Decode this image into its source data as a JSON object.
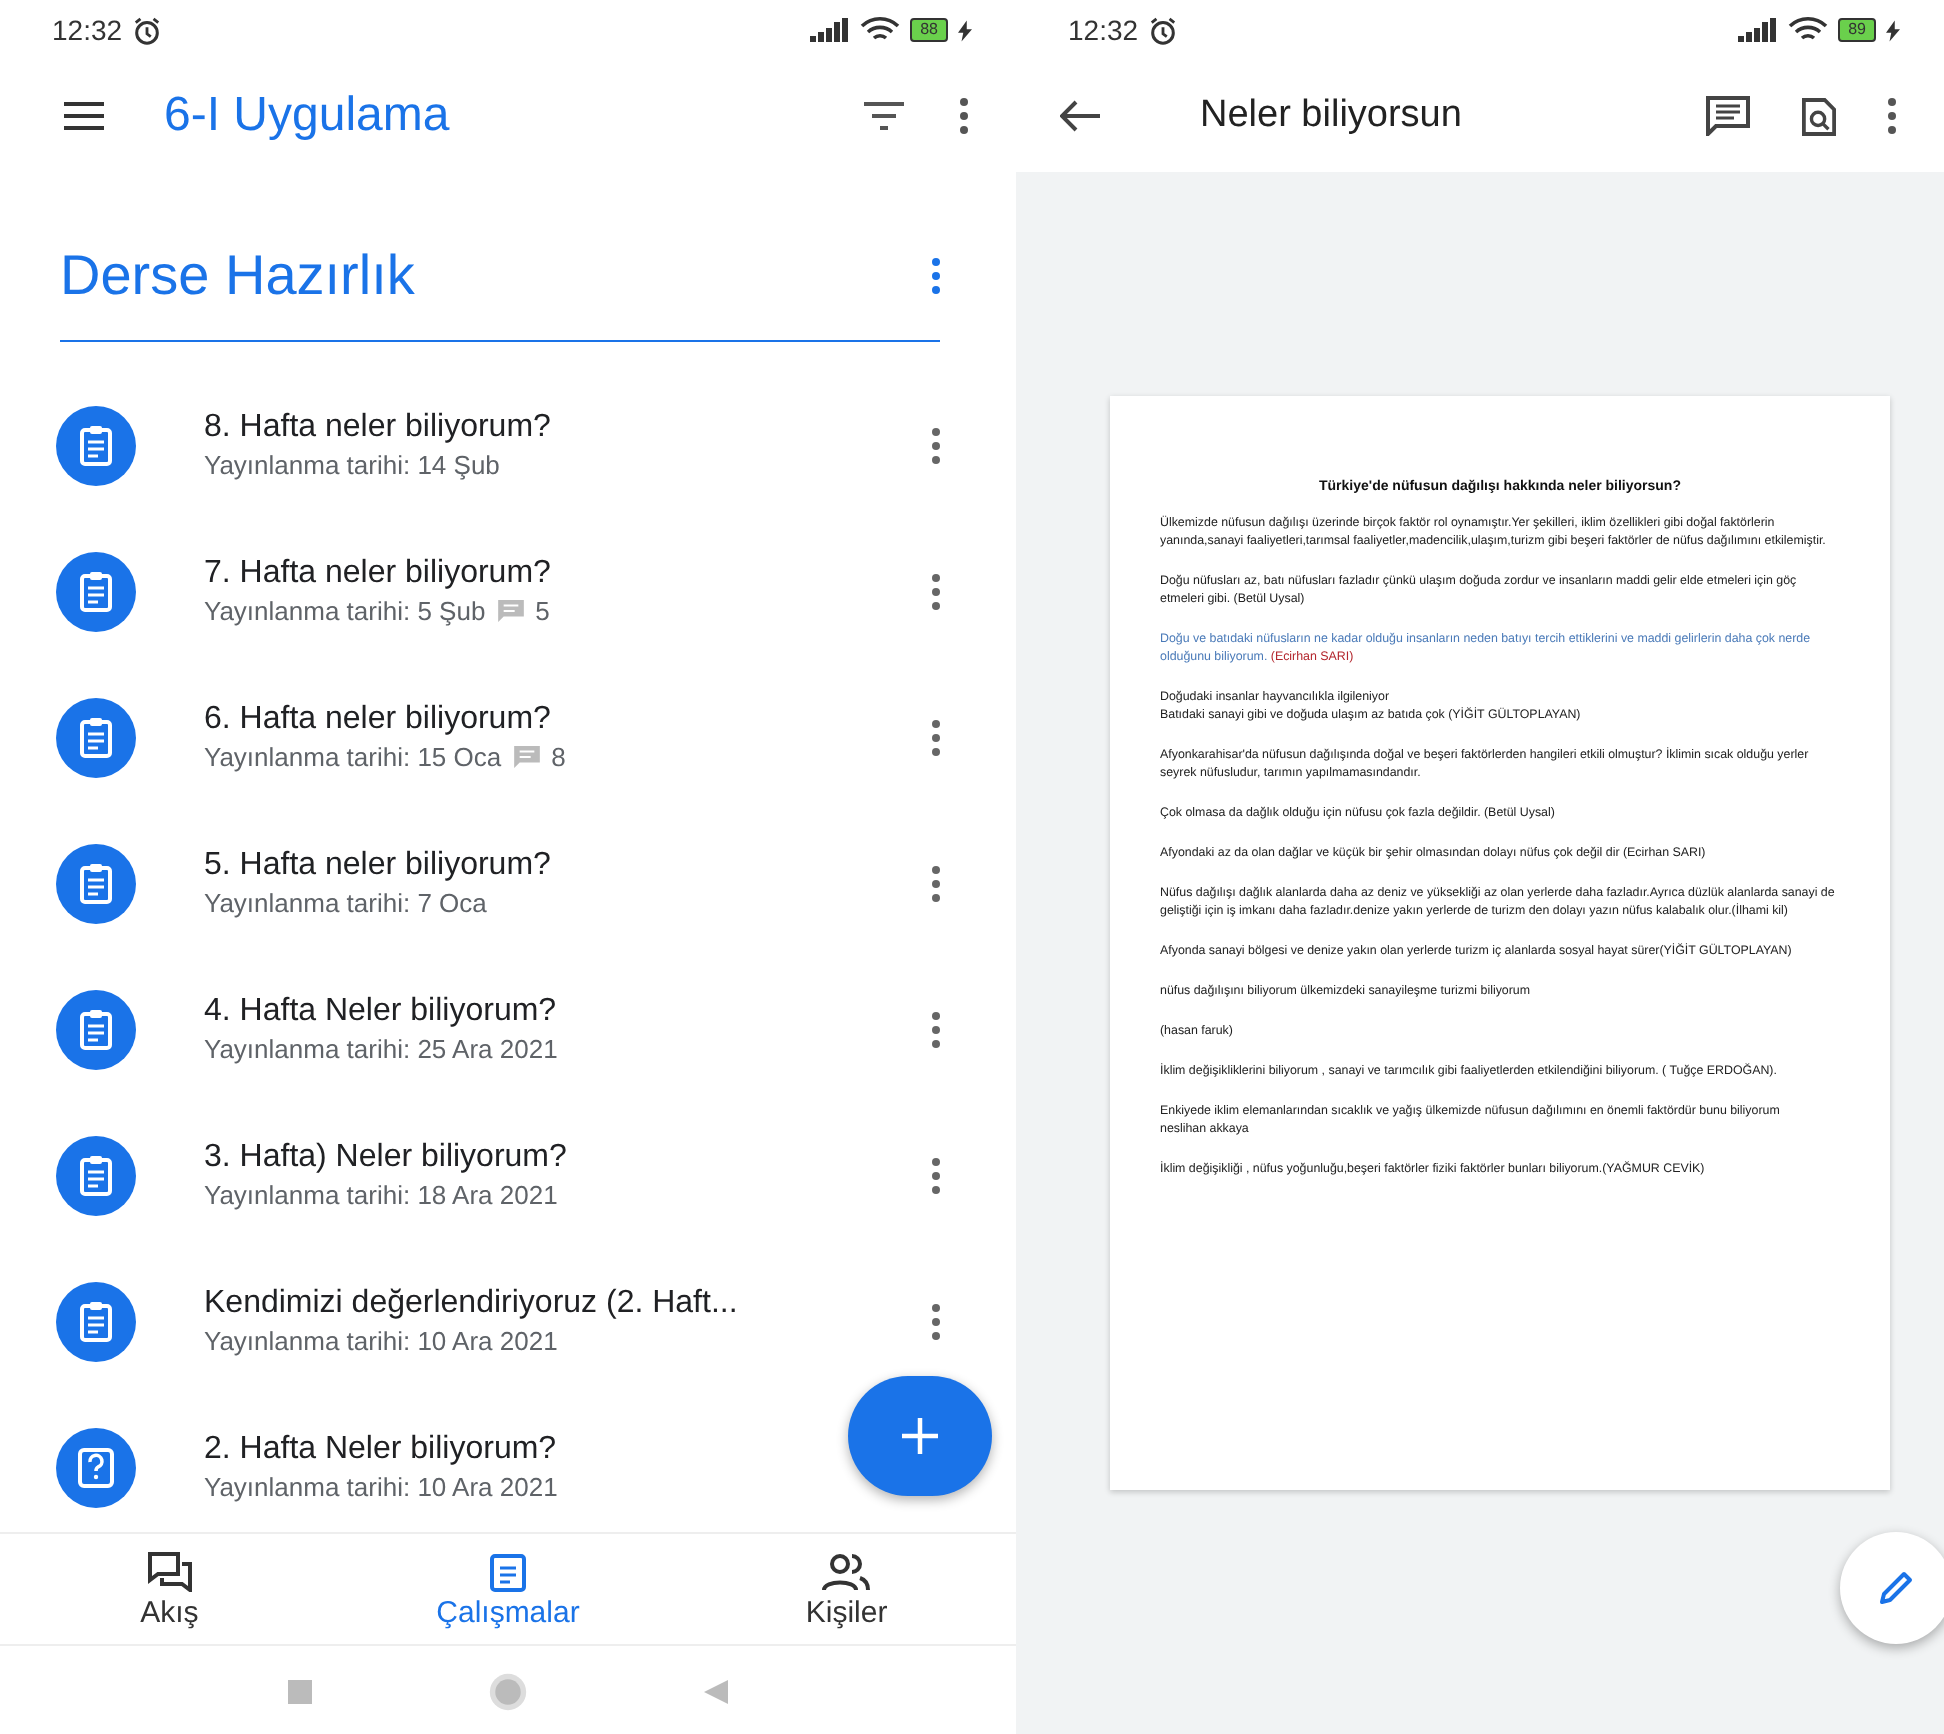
{
  "left_phone": {
    "status_bar": {
      "time": "12:32",
      "battery": "88"
    },
    "app_bar": {
      "title": "6-I Uygulama"
    },
    "topic": {
      "title": "Derse Hazırlık"
    },
    "assignments": [
      {
        "kind": "assignment",
        "title": "8. Hafta neler biliyorum?",
        "date": "Yayınlanma tarihi: 14 Şub"
      },
      {
        "kind": "assignment",
        "title": "7. Hafta neler biliyorum?",
        "date": "Yayınlanma tarihi: 5 Şub",
        "comments": "5"
      },
      {
        "kind": "assignment",
        "title": "6. Hafta neler biliyorum?",
        "date": "Yayınlanma tarihi: 15 Oca",
        "comments": "8"
      },
      {
        "kind": "assignment",
        "title": "5. Hafta neler biliyorum?",
        "date": "Yayınlanma tarihi: 7 Oca"
      },
      {
        "kind": "assignment",
        "title": "4. Hafta Neler biliyorum?",
        "date": "Yayınlanma tarihi: 25 Ara 2021"
      },
      {
        "kind": "assignment",
        "title": "3. Hafta) Neler biliyorum?",
        "date": "Yayınlanma tarihi: 18 Ara 2021"
      },
      {
        "kind": "assignment",
        "title": "Kendimizi değerlendiriyoruz (2. Haft...",
        "date": "Yayınlanma tarihi: 10 Ara 2021"
      },
      {
        "kind": "question",
        "title": "2. Hafta Neler biliyorum?",
        "date": "Yayınlanma tarihi: 10 Ara 2021"
      }
    ],
    "bottom_nav": [
      {
        "kind": "stream",
        "label": "Akış",
        "selected": false
      },
      {
        "kind": "classwork",
        "label": "Çalışmalar",
        "selected": true
      },
      {
        "kind": "people",
        "label": "Kişiler",
        "selected": false
      }
    ]
  },
  "right_phone": {
    "status_bar": {
      "time": "12:32",
      "battery": "89"
    },
    "app_bar": {
      "title": "Neler biliyorsun"
    },
    "document": {
      "title": "Türkiye'de nüfusun dağılışı hakkında neler biliyorsun?",
      "paragraphs": [
        {
          "parts": [
            {
              "text": " Ülkemizde nüfusun dağılışı üzerinde birçok faktör rol oynamıştır.Yer şekilleri, iklim özellikleri gibi  doğal faktörlerin yanında,sanayi faaliyetleri,tarımsal faaliyetler,madencilik,ulaşım,turizm gibi beşeri faktörler de nüfus dağılımını etkilemiştir.",
              "color": "#222222"
            }
          ]
        },
        {
          "parts": [
            {
              "text": "Doğu nüfusları az, batı nüfusları fazladır çünkü ulaşım doğuda zordur ve insanların maddi gelir elde etmeleri için göç etmeleri gibi. (Betül Uysal)",
              "color": "#222222"
            }
          ]
        },
        {
          "parts": [
            {
              "text": "Doğu ve batıdaki nüfusların ne kadar olduğu insanların neden batıyı tercih ettiklerini ve maddi gelirlerin daha çok nerde olduğunu biliyorum. ",
              "color": "#4a7ab8"
            },
            {
              "text": "(Ecirhan SARI)",
              "color": "#b3262d"
            }
          ]
        },
        {
          "parts": [
            {
              "text": "Doğudaki insanlar hayvancılıkla ilgileniyor\nBatıdaki sanayi gibi ve doğuda ulaşım az batıda çok (YİĞİT GÜLTOPLAYAN)",
              "color": "#222222"
            }
          ]
        },
        {
          "parts": [
            {
              "text": "Afyonkarahisar'da nüfusun dağılışında  doğal ve beşeri faktörlerden hangileri etkili olmuştur?   İklimin sıcak olduğu yerler seyrek nüfusludur, tarımın yapılmamasındandır.",
              "color": "#222222"
            }
          ]
        },
        {
          "parts": [
            {
              "text": "Çok olmasa da dağlık olduğu için nüfusu çok fazla değildir. (Betül Uysal)",
              "color": "#222222"
            }
          ]
        },
        {
          "parts": [
            {
              "text": "Afyondaki az da olan dağlar ve küçük bir şehir olmasından dolayı nüfus çok değil dir (Ecirhan SARI)",
              "color": "#222222"
            }
          ]
        },
        {
          "parts": [
            {
              "text": "Nüfus dağılışı dağlık alanlarda daha az deniz ve yüksekliği az olan yerlerde daha fazladır.Ayrıca düzlük alanlarda sanayi de geliştiği için iş imkanı daha fazladır.denize yakın yerlerde de turizm den dolayı yazın nüfus kalabalık olur.(İlhami kil)",
              "color": "#222222"
            }
          ]
        },
        {
          "parts": [
            {
              "text": "Afyonda sanayi bölgesi ve denize yakın olan yerlerde turizm iç alanlarda sosyal hayat sürer(YİĞİT GÜLTOPLAYAN)",
              "color": "#222222"
            }
          ]
        },
        {
          "parts": [
            {
              "text": "nüfus dağılışını biliyorum ülkemizdeki sanayileşme turizmi biliyorum",
              "color": "#222222"
            }
          ]
        },
        {
          "parts": [
            {
              "text": "(hasan faruk)",
              "color": "#222222"
            }
          ]
        },
        {
          "parts": [
            {
              "text": "İklim değişikliklerini biliyorum , sanayi ve tarımcılık gibi faaliyetlerden etkilendiğini biliyorum. ( Tuğçe ERDOĞAN).",
              "color": "#222222"
            }
          ]
        },
        {
          "parts": [
            {
              "text": "Enkiyede iklim elemanlarından sıcaklık ve yağış ülkemizde nüfusun dağılımını en önemli faktördür bunu biliyorum\nneslihan akkaya",
              "color": "#222222"
            }
          ]
        },
        {
          "parts": [
            {
              "text": "İklim değişikliği , nüfus yoğunluğu,beşeri faktörler fiziki faktörler bunları biliyorum.(YAĞMUR CEVİK)",
              "color": "#222222"
            }
          ]
        }
      ]
    }
  }
}
